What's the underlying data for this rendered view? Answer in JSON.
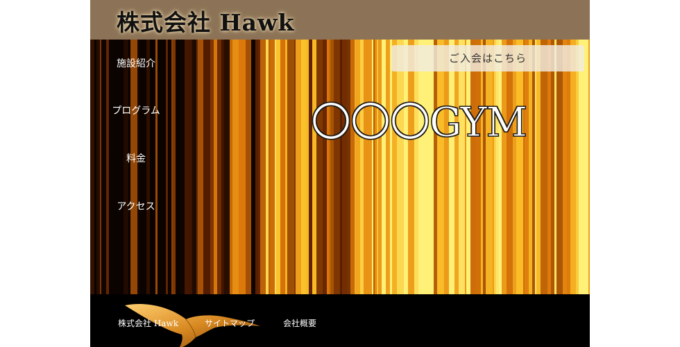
{
  "header": {
    "company_title": "株式会社 Hawk"
  },
  "nav": {
    "items": [
      {
        "label": "施設紹介"
      },
      {
        "label": "プログラム"
      },
      {
        "label": "料金"
      },
      {
        "label": "アクセス"
      }
    ]
  },
  "hero": {
    "signup_label": "ご入会はこちら",
    "gym_title": "〇〇〇GYM"
  },
  "footer": {
    "links": [
      {
        "label": "株式会社 Hawk"
      },
      {
        "label": "サイトマップ"
      },
      {
        "label": "会社概要"
      }
    ]
  },
  "colors": {
    "header_bg": "#8c7357",
    "page_bg": "#000000",
    "accent_gold": "#f5a623"
  }
}
